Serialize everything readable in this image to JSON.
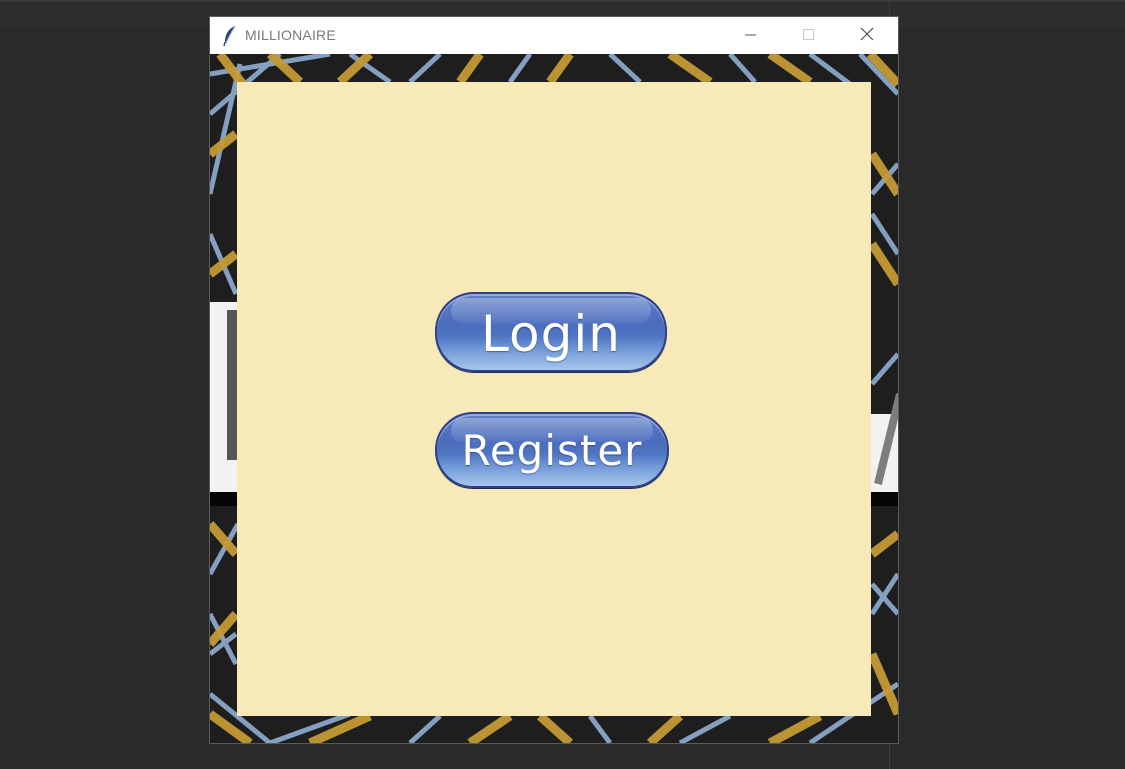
{
  "window": {
    "title": "MILLIONAIRE",
    "icon": "feather-icon",
    "controls": [
      "minimize-icon",
      "maximize-icon",
      "close-icon"
    ]
  },
  "buttons": {
    "login_label": "Login",
    "register_label": "Register"
  },
  "colors": {
    "panel": "#f7eab8",
    "button_fill": "#4e74c2",
    "button_border": "#2f3f86",
    "desktop": "#2a2a2a"
  }
}
